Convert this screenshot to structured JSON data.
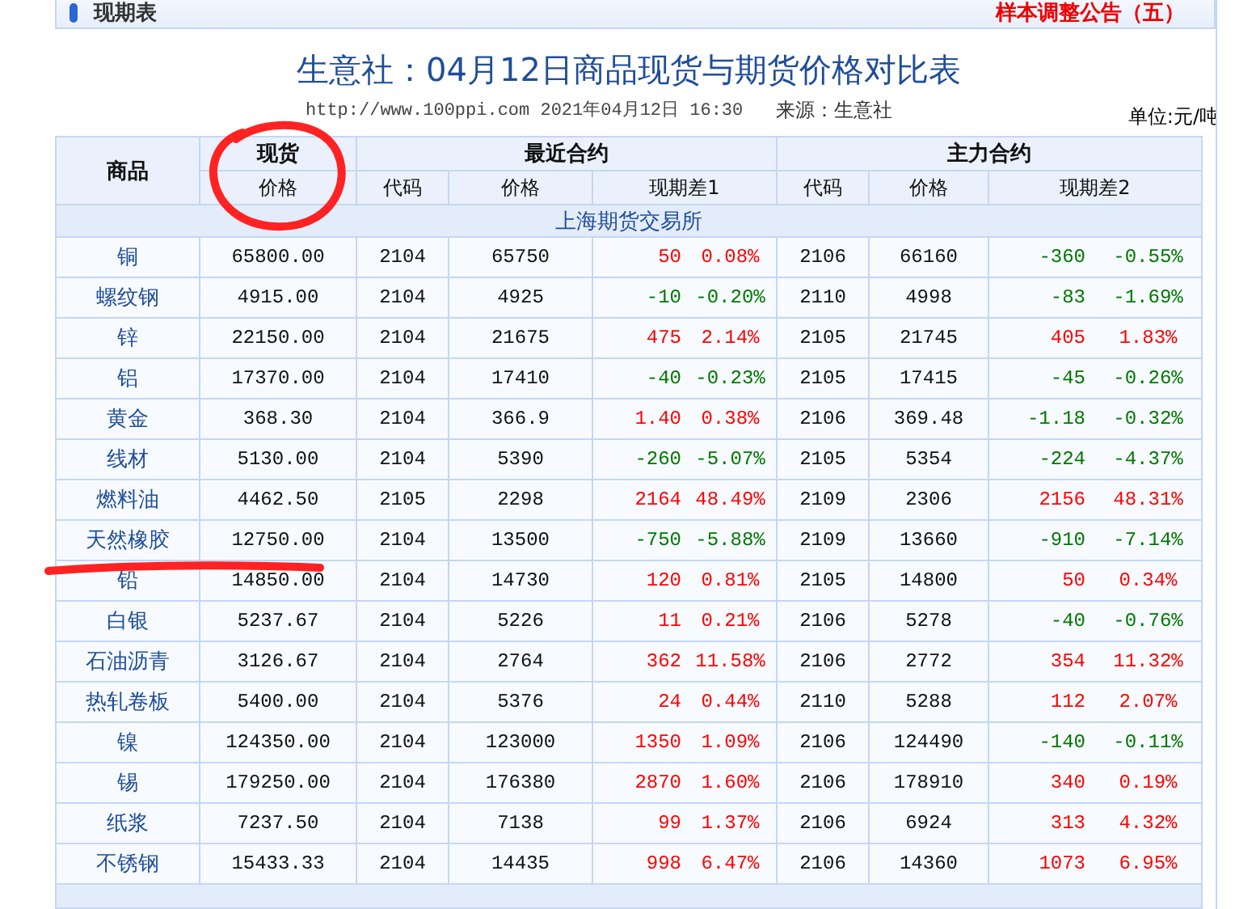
{
  "section_bar": {
    "title": "现期表",
    "notice_link": "样本调整公告（五）"
  },
  "title": "生意社：04月12日商品现货与期货价格对比表",
  "meta": {
    "url_time": "http://www.100ppi.com 2021年04月12日 16:30",
    "source": "来源：生意社",
    "unit": "单位:元/吨"
  },
  "table": {
    "header_groups": [
      "商品",
      "现货",
      "最近合约",
      "主力合约"
    ],
    "columns": [
      "价格",
      "代码",
      "价格",
      "现期差1",
      "代码",
      "价格",
      "现期差2"
    ],
    "exchange": "上海期货交易所",
    "rows": [
      {
        "name": "铜",
        "spot": "65800.00",
        "code1": "2104",
        "price1": "65750",
        "diff1": "50",
        "pct1": "0.08%",
        "rising1": true,
        "code2": "2106",
        "price2": "66160",
        "diff2": "-360",
        "pct2": "-0.55%",
        "rising2": false
      },
      {
        "name": "螺纹钢",
        "spot": "4915.00",
        "code1": "2104",
        "price1": "4925",
        "diff1": "-10",
        "pct1": "-0.20%",
        "rising1": false,
        "code2": "2110",
        "price2": "4998",
        "diff2": "-83",
        "pct2": "-1.69%",
        "rising2": false
      },
      {
        "name": "锌",
        "spot": "22150.00",
        "code1": "2104",
        "price1": "21675",
        "diff1": "475",
        "pct1": "2.14%",
        "rising1": true,
        "code2": "2105",
        "price2": "21745",
        "diff2": "405",
        "pct2": "1.83%",
        "rising2": true
      },
      {
        "name": "铝",
        "spot": "17370.00",
        "code1": "2104",
        "price1": "17410",
        "diff1": "-40",
        "pct1": "-0.23%",
        "rising1": false,
        "code2": "2105",
        "price2": "17415",
        "diff2": "-45",
        "pct2": "-0.26%",
        "rising2": false
      },
      {
        "name": "黄金",
        "spot": "368.30",
        "code1": "2104",
        "price1": "366.9",
        "diff1": "1.40",
        "pct1": "0.38%",
        "rising1": true,
        "code2": "2106",
        "price2": "369.48",
        "diff2": "-1.18",
        "pct2": "-0.32%",
        "rising2": false
      },
      {
        "name": "线材",
        "spot": "5130.00",
        "code1": "2104",
        "price1": "5390",
        "diff1": "-260",
        "pct1": "-5.07%",
        "rising1": false,
        "code2": "2105",
        "price2": "5354",
        "diff2": "-224",
        "pct2": "-4.37%",
        "rising2": false
      },
      {
        "name": "燃料油",
        "spot": "4462.50",
        "code1": "2105",
        "price1": "2298",
        "diff1": "2164",
        "pct1": "48.49%",
        "rising1": true,
        "code2": "2109",
        "price2": "2306",
        "diff2": "2156",
        "pct2": "48.31%",
        "rising2": true
      },
      {
        "name": "天然橡胶",
        "spot": "12750.00",
        "code1": "2104",
        "price1": "13500",
        "diff1": "-750",
        "pct1": "-5.88%",
        "rising1": false,
        "code2": "2109",
        "price2": "13660",
        "diff2": "-910",
        "pct2": "-7.14%",
        "rising2": false
      },
      {
        "name": "铅",
        "spot": "14850.00",
        "code1": "2104",
        "price1": "14730",
        "diff1": "120",
        "pct1": "0.81%",
        "rising1": true,
        "code2": "2105",
        "price2": "14800",
        "diff2": "50",
        "pct2": "0.34%",
        "rising2": true
      },
      {
        "name": "白银",
        "spot": "5237.67",
        "code1": "2104",
        "price1": "5226",
        "diff1": "11",
        "pct1": "0.21%",
        "rising1": true,
        "code2": "2106",
        "price2": "5278",
        "diff2": "-40",
        "pct2": "-0.76%",
        "rising2": false
      },
      {
        "name": "石油沥青",
        "spot": "3126.67",
        "code1": "2104",
        "price1": "2764",
        "diff1": "362",
        "pct1": "11.58%",
        "rising1": true,
        "code2": "2106",
        "price2": "2772",
        "diff2": "354",
        "pct2": "11.32%",
        "rising2": true
      },
      {
        "name": "热轧卷板",
        "spot": "5400.00",
        "code1": "2104",
        "price1": "5376",
        "diff1": "24",
        "pct1": "0.44%",
        "rising1": true,
        "code2": "2110",
        "price2": "5288",
        "diff2": "112",
        "pct2": "2.07%",
        "rising2": true
      },
      {
        "name": "镍",
        "spot": "124350.00",
        "code1": "2104",
        "price1": "123000",
        "diff1": "1350",
        "pct1": "1.09%",
        "rising1": true,
        "code2": "2106",
        "price2": "124490",
        "diff2": "-140",
        "pct2": "-0.11%",
        "rising2": false
      },
      {
        "name": "锡",
        "spot": "179250.00",
        "code1": "2104",
        "price1": "176380",
        "diff1": "2870",
        "pct1": "1.60%",
        "rising1": true,
        "code2": "2106",
        "price2": "178910",
        "diff2": "340",
        "pct2": "0.19%",
        "rising2": true
      },
      {
        "name": "纸浆",
        "spot": "7237.50",
        "code1": "2104",
        "price1": "7138",
        "diff1": "99",
        "pct1": "1.37%",
        "rising1": true,
        "code2": "2106",
        "price2": "6924",
        "diff2": "313",
        "pct2": "4.32%",
        "rising2": true
      },
      {
        "name": "不锈钢",
        "spot": "15433.33",
        "code1": "2104",
        "price1": "14435",
        "diff1": "998",
        "pct1": "6.47%",
        "rising1": true,
        "code2": "2106",
        "price2": "14360",
        "diff2": "1073",
        "pct2": "6.95%",
        "rising2": true
      }
    ]
  }
}
